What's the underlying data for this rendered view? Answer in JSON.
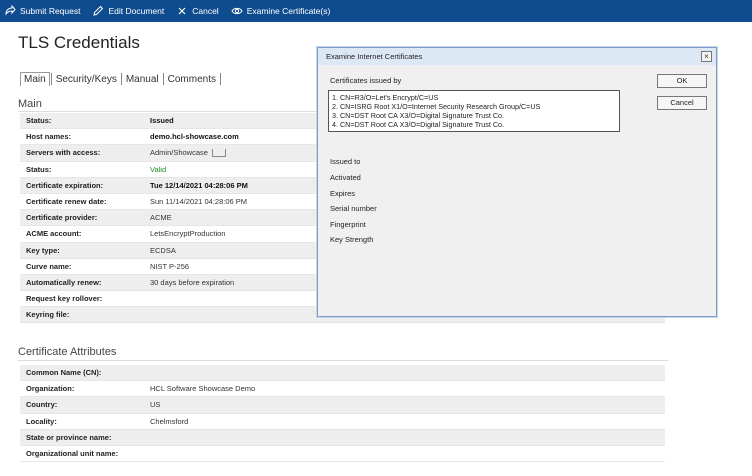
{
  "toolbar": {
    "submit_request": "Submit Request",
    "edit_document": "Edit Document",
    "cancel": "Cancel",
    "examine_certificates": "Examine Certificate(s)"
  },
  "page_title": "TLS Credentials",
  "tabs": [
    "Main",
    "Security/Keys",
    "Manual",
    "Comments"
  ],
  "main_section": {
    "title": "Main",
    "rows": [
      {
        "label": "Status:",
        "value": "Issued"
      },
      {
        "label": "Host names:",
        "value": "demo.hcl-showcase.com"
      },
      {
        "label": "Servers with access:",
        "value": "Admin/Showcase"
      },
      {
        "label": "Status:",
        "value": "Valid"
      },
      {
        "label": "Certificate expiration:",
        "value": "Tue 12/14/2021 04:28:06 PM"
      },
      {
        "label": "Certificate renew date:",
        "value": "Sun 11/14/2021 04:28:06 PM"
      },
      {
        "label": "Certificate provider:",
        "value": "ACME"
      },
      {
        "label": "ACME account:",
        "value": "LetsEncryptProduction"
      },
      {
        "label": "Key type:",
        "value": "ECDSA"
      },
      {
        "label": "Curve name:",
        "value": "NIST P-256"
      },
      {
        "label": "Automatically renew:",
        "value": "30 days before expiration"
      },
      {
        "label": "Request key rollover:",
        "value": ""
      },
      {
        "label": "Keyring file:",
        "value": ""
      }
    ]
  },
  "attributes_section": {
    "title": "Certificate Attributes",
    "rows": [
      {
        "label": "Common Name (CN):",
        "value": ""
      },
      {
        "label": "Organization:",
        "value": "HCL Software Showcase Demo"
      },
      {
        "label": "Country:",
        "value": "US"
      },
      {
        "label": "Locality:",
        "value": "Chelmsford"
      },
      {
        "label": "State or province name:",
        "value": ""
      },
      {
        "label": "Organizational unit name:",
        "value": ""
      }
    ]
  },
  "dialog": {
    "title": "Examine Internet Certificates",
    "close_glyph": "×",
    "issued_by_label": "Certificates issued by",
    "certificates": [
      "1. CN=R3/O=Let's Encrypt/C=US",
      "2. CN=ISRG Root X1/O=Internet Security Research Group/C=US",
      "3. CN=DST Root CA X3/O=Digital Signature Trust Co.",
      "4. CN=DST Root CA X3/O=Digital Signature Trust Co."
    ],
    "fields": [
      "Issued to",
      "Activated",
      "Expires",
      "Serial number",
      "Fingerprint",
      "Key Strength"
    ],
    "ok_label": "OK",
    "cancel_label": "Cancel"
  },
  "colors": {
    "toolbar_bg": "#0f4c8f",
    "valid_green": "#1e8a1e",
    "dialog_border": "#7a9cc6"
  }
}
